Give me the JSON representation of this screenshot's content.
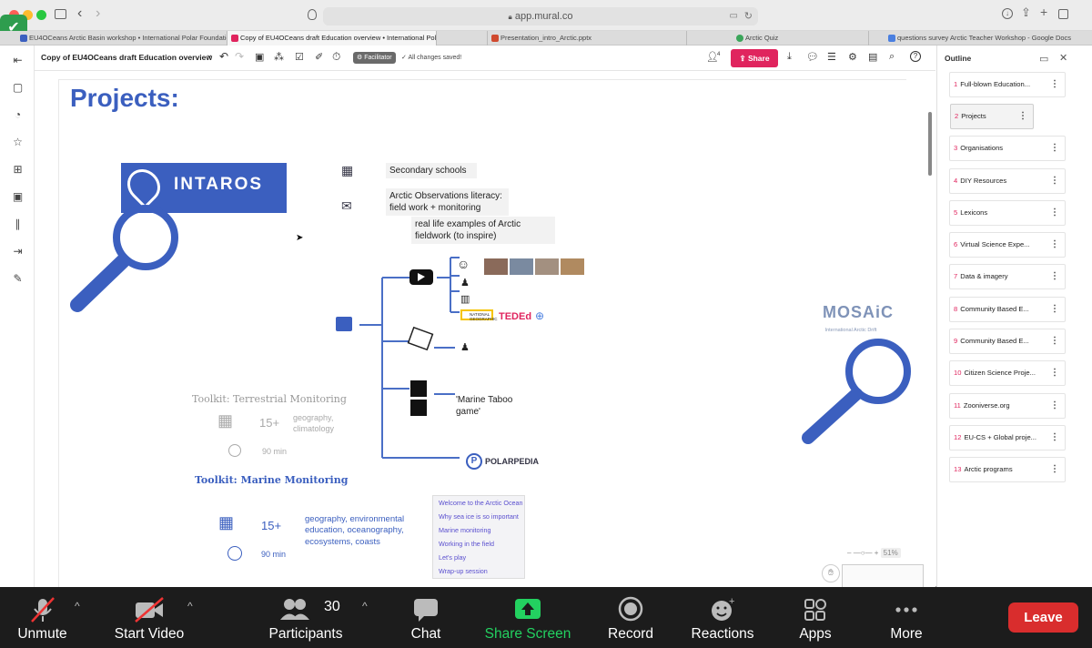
{
  "browser": {
    "url": "app.mural.co",
    "tabs": [
      {
        "label": "EU4OCeans Arctic Basin workshop • International Polar Foundation",
        "color": "#3b5fbf",
        "active": false
      },
      {
        "label": "Copy of EU4OCeans draft Education overview • International Polar...",
        "color": "#e0245e",
        "active": true
      },
      {
        "label": "Presentation_intro_Arctic.pptx",
        "color": "#d04a2f",
        "active": false
      },
      {
        "label": "Arctic Quiz",
        "color": "#3aa55a",
        "active": false
      },
      {
        "label": "questions survey Arctic Teacher Workshop - Google Docs",
        "color": "#4a7fe0",
        "active": false
      }
    ]
  },
  "toolbar": {
    "doc_title": "Copy of EU4OCeans draft Education overview",
    "facilitator_label": "Facilitator",
    "saved_status": "All changes saved!",
    "participants_count": "4",
    "share_label": "Share",
    "accent": "#e0245e"
  },
  "board": {
    "title": "Projects:",
    "intaros_label": "INTAROS",
    "mosaic_label": "MOSAiC",
    "mosaic_sub": "International Arctic Drift",
    "notes": {
      "secondary": "Secondary schools",
      "literacy": "Arctic Observations literacy: field work + monitoring",
      "real_life": "real life examples of Arctic fieldwork (to inspire)",
      "taboo": "'Marine Taboo game'",
      "polarpedia": "POLARPEDIA",
      "tedEd": "TEDEd",
      "natgeo": "NATIONAL GEOGRAPHIC"
    },
    "toolkit_terrestrial": {
      "title": "Toolkit: Terrestrial Monitoring",
      "age": "15+",
      "subjects": "geography, climatology",
      "duration": "90 min"
    },
    "toolkit_marine": {
      "title": "Toolkit: Marine Monitoring",
      "age": "15+",
      "subjects": "geography, environmental education, oceanography, ecosystems, coasts",
      "duration": "90 min"
    },
    "lesson_menu": [
      "Welcome to the Arctic Ocean",
      "Why sea ice is so important",
      "Marine monitoring",
      "Working in the field",
      "Let's play",
      "Wrap-up session"
    ],
    "zoom_level": "51%"
  },
  "outline": {
    "title": "Outline",
    "items": [
      {
        "num": "1",
        "label": "Full-blown Education..."
      },
      {
        "num": "2",
        "label": "Projects"
      },
      {
        "num": "3",
        "label": "Organisations"
      },
      {
        "num": "4",
        "label": "DIY Resources"
      },
      {
        "num": "5",
        "label": "Lexicons"
      },
      {
        "num": "6",
        "label": "Virtual Science Expe..."
      },
      {
        "num": "7",
        "label": "Data & imagery"
      },
      {
        "num": "8",
        "label": "Community Based E..."
      },
      {
        "num": "9",
        "label": "Community Based E..."
      },
      {
        "num": "10",
        "label": "Citizen Science Proje..."
      },
      {
        "num": "11",
        "label": "Zooniverse.org"
      },
      {
        "num": "12",
        "label": "EU-CS + Global proje..."
      },
      {
        "num": "13",
        "label": "Arctic programs"
      }
    ]
  },
  "zoom_bar": {
    "unmute": "Unmute",
    "start_video": "Start Video",
    "participants": "Participants",
    "participants_count": "30",
    "chat": "Chat",
    "share_screen": "Share Screen",
    "record": "Record",
    "reactions": "Reactions",
    "apps": "Apps",
    "more": "More",
    "leave": "Leave",
    "share_color": "#23d160",
    "leave_color": "#d92d2d"
  }
}
